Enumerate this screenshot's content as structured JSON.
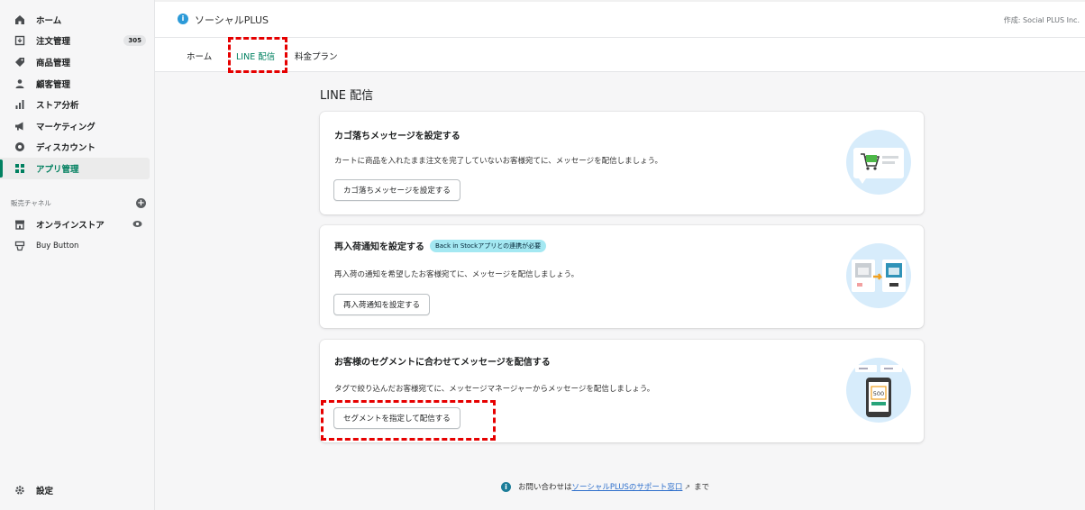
{
  "sidebar": {
    "items": [
      {
        "label": "ホーム",
        "icon": "home-icon"
      },
      {
        "label": "注文管理",
        "icon": "orders-icon",
        "badge": "305"
      },
      {
        "label": "商品管理",
        "icon": "tag-icon"
      },
      {
        "label": "顧客管理",
        "icon": "person-icon"
      },
      {
        "label": "ストア分析",
        "icon": "bar-chart-icon"
      },
      {
        "label": "マーケティング",
        "icon": "megaphone-icon"
      },
      {
        "label": "ディスカウント",
        "icon": "discount-icon"
      },
      {
        "label": "アプリ管理",
        "icon": "apps-icon",
        "active": true
      }
    ],
    "channels_heading": "販売チャネル",
    "channels": [
      {
        "label": "オンラインストア",
        "icon": "store-icon"
      },
      {
        "label": "Buy Button",
        "icon": "buy-button-icon"
      }
    ],
    "settings_label": "設定"
  },
  "topbar": {
    "app_title": "ソーシャルPLUS",
    "creator": "作成: Social PLUS Inc."
  },
  "tabs": [
    {
      "label": "ホーム"
    },
    {
      "label": "LINE 配信",
      "active": true
    },
    {
      "label": "料金プラン"
    }
  ],
  "page": {
    "title": "LINE 配信",
    "cards": [
      {
        "title": "カゴ落ちメッセージを設定する",
        "description": "カートに商品を入れたまま注文を完了していないお客様宛てに、メッセージを配信しましょう。",
        "button": "カゴ落ちメッセージを設定する"
      },
      {
        "title": "再入荷通知を設定する",
        "pill": "Back in Stockアプリとの連携が必要",
        "description": "再入荷の通知を希望したお客様宛てに、メッセージを配信しましょう。",
        "button": "再入荷通知を設定する"
      },
      {
        "title": "お客様のセグメントに合わせてメッセージを配信する",
        "description": "タグで絞り込んだお客様宛てに、メッセージマネージャーからメッセージを配信しましょう。",
        "button": "セグメントを指定して配信する",
        "illustration_price": "500"
      }
    ]
  },
  "footer": {
    "prefix": "お問い合わせは",
    "link": "ソーシャルPLUSのサポート窓口",
    "suffix": "まで"
  },
  "colors": {
    "accent": "#008060",
    "highlight": "#e60000",
    "link": "#2c6ecb"
  }
}
